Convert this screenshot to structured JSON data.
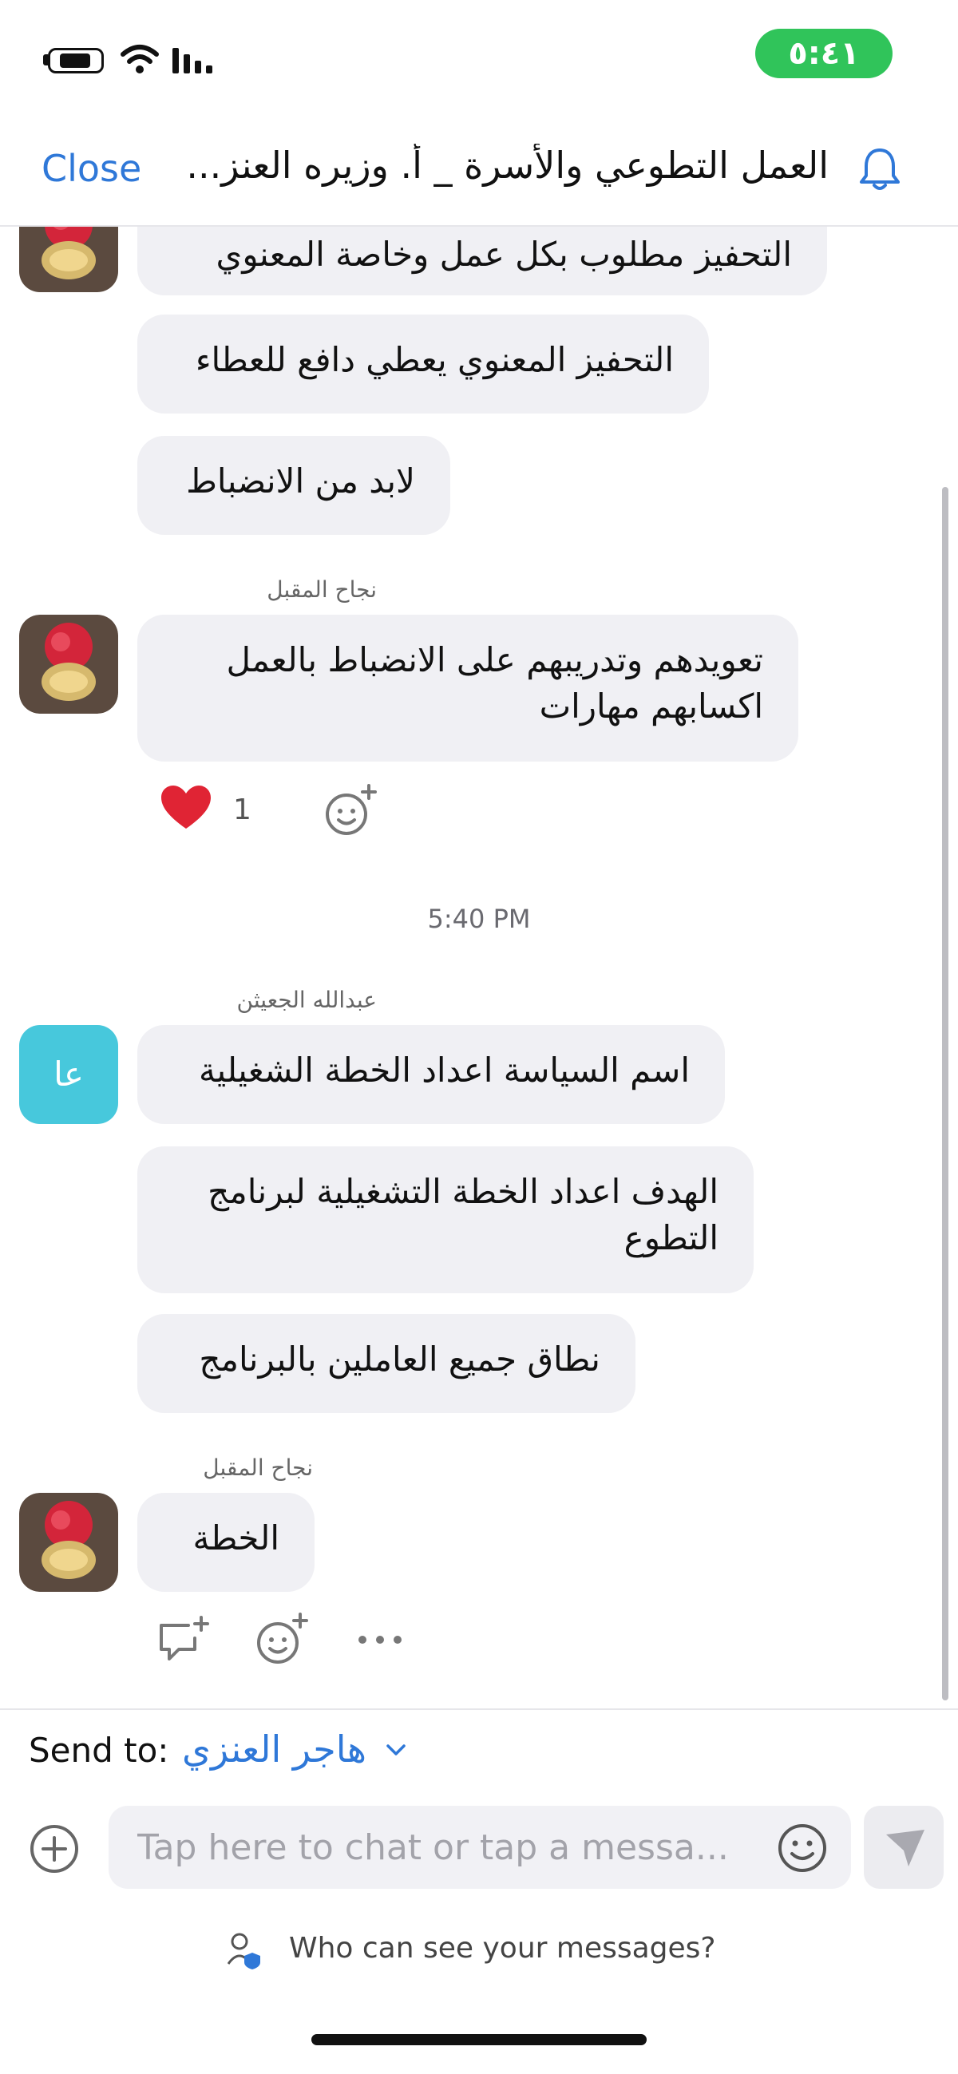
{
  "status_bar": {
    "time": "٥:٤١",
    "accent": "#30c45a"
  },
  "header": {
    "close_label": "Close",
    "title": "العمل التطوعي والأسرة _ أ. وزيره العنز...",
    "bell_icon": "bell-icon",
    "accent": "#2f78d8"
  },
  "messages": {
    "group1": {
      "m1": "التحفيز مطلوب بكل عمل  وخاصة المعنوي",
      "m2": "التحفيز المعنوي يعطي دافع للعطاء",
      "m3": "لابد من الانضباط"
    },
    "group2": {
      "sender": "نجاح المقبل",
      "m1_line1": "تعويدهم وتدريبهم  على الانضباط بالعمل",
      "m1_line2": "اكسابهم مهارات",
      "reaction_count": "1"
    },
    "timestamp": "5:40 PM",
    "group3": {
      "sender": "عبدالله الجعيثن",
      "avatar_initials": "عا",
      "m1": "اسم السياسة اعداد الخطة الشغيلية",
      "m2_line1": "الهدف اعداد الخطة التشغيلية لبرنامج",
      "m2_line2": "التطوع",
      "m3": "نطاق جميع العاملين بالبرنامج"
    },
    "group4": {
      "sender": "نجاح المقبل",
      "m1": "الخطة"
    }
  },
  "composer": {
    "send_to_label": "Send to:",
    "send_to_value": "هاجر العنزي",
    "input_placeholder": "Tap here to chat or tap a messa...",
    "privacy_text": "Who can see your messages?"
  }
}
